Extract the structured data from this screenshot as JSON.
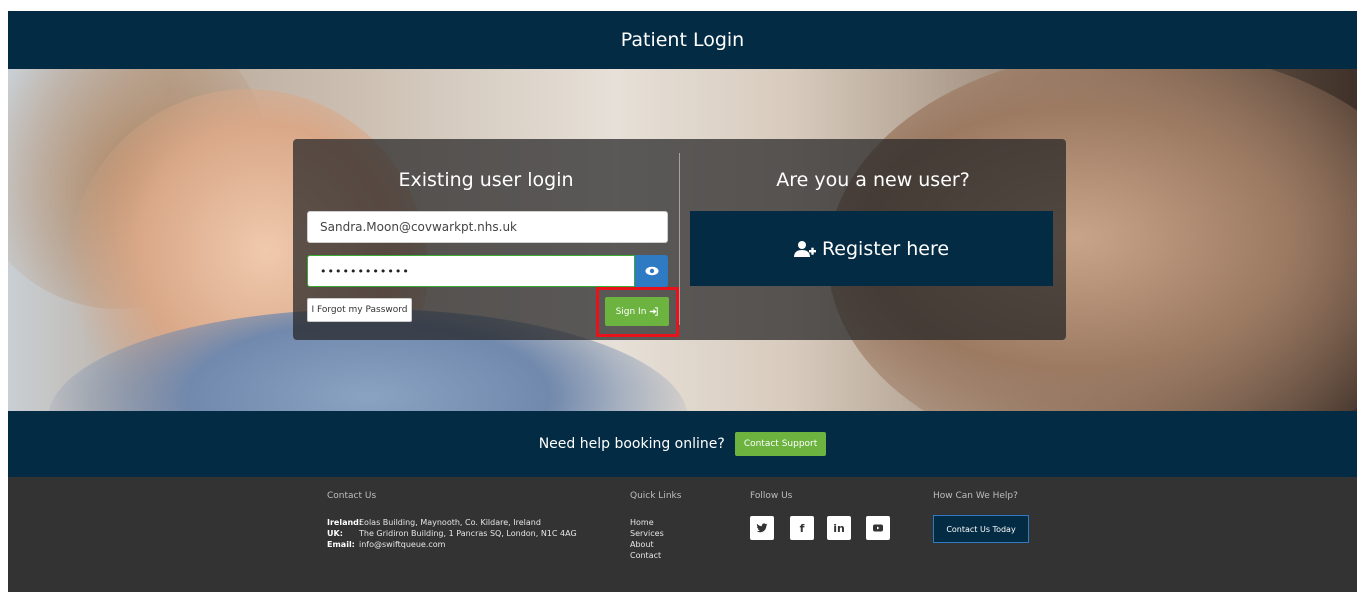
{
  "header": {
    "title": "Patient Login"
  },
  "login": {
    "title": "Existing user login",
    "email_value": "Sandra.Moon@covwarkpt.nhs.uk",
    "password_value": "••••••••••••",
    "forgot_label": "I Forgot my Password",
    "signin_label": "Sign In"
  },
  "register": {
    "title": "Are you a new user?",
    "button_label": "Register here"
  },
  "help": {
    "text": "Need help booking online?",
    "button_label": "Contact Support"
  },
  "footer": {
    "contact_title": "Contact Us",
    "address": [
      {
        "label": "Ireland:",
        "value": "Eolas Building, Maynooth, Co. Kildare, Ireland"
      },
      {
        "label": "UK:",
        "value": "The Gridiron Building, 1 Pancras SQ, London, N1C 4AG"
      },
      {
        "label": "Email:",
        "value": "info@swiftqueue.com"
      }
    ],
    "quick_links_title": "Quick Links",
    "quick_links": [
      "Home",
      "Services",
      "About",
      "Contact"
    ],
    "follow_title": "Follow Us",
    "social": {
      "facebook_glyph": "f",
      "linkedin_glyph": "in"
    },
    "help_title": "How Can We Help?",
    "contact_today_label": "Contact Us Today"
  },
  "colors": {
    "navy": "#032b43",
    "green": "#6cb33f",
    "blue": "#2e7bc4",
    "highlight": "#e8121b",
    "footer": "#333333"
  }
}
